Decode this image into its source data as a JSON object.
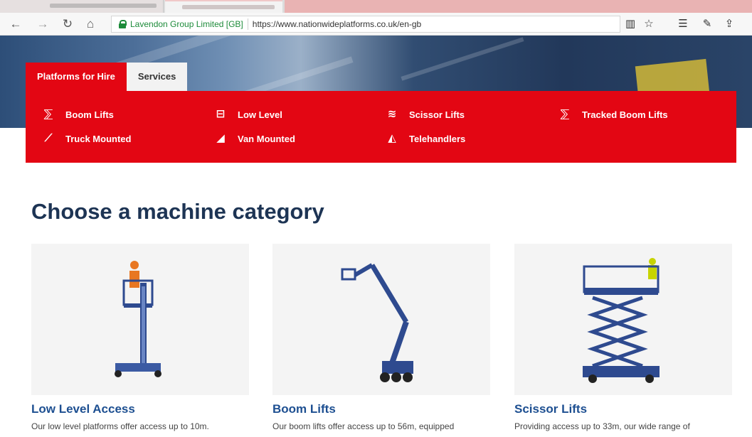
{
  "browser": {
    "cert_name": "Lavendon Group Limited [GB]",
    "url": "https://www.nationwideplatforms.co.uk/en-gb",
    "nav_icons": [
      "back-icon",
      "forward-icon",
      "refresh-icon",
      "home-icon"
    ],
    "right_icons": [
      "reading-view-icon",
      "favorite-star-icon",
      "favorites-hub-icon",
      "pen-icon",
      "share-icon"
    ]
  },
  "header": {
    "tabs": [
      {
        "label": "Platforms for Hire",
        "active": true
      },
      {
        "label": "Services",
        "active": false
      }
    ],
    "menu": [
      {
        "label": "Boom Lifts",
        "icon": "boom-lift-icon"
      },
      {
        "label": "Low Level",
        "icon": "low-level-icon"
      },
      {
        "label": "Scissor Lifts",
        "icon": "scissor-lift-icon"
      },
      {
        "label": "Tracked Boom Lifts",
        "icon": "tracked-boom-lift-icon"
      },
      {
        "label": "Truck Mounted",
        "icon": "truck-mounted-icon"
      },
      {
        "label": "Van Mounted",
        "icon": "van-mounted-icon"
      },
      {
        "label": "Telehandlers",
        "icon": "telehandler-icon"
      }
    ],
    "colors": {
      "red": "#e30613",
      "navy": "#1d3454"
    }
  },
  "main": {
    "heading": "Choose a machine category",
    "cards": [
      {
        "title": "Low Level Access",
        "desc": "Our low level platforms offer access up to 10m."
      },
      {
        "title": "Boom Lifts",
        "desc": "Our boom lifts offer access up to 56m, equipped"
      },
      {
        "title": "Scissor Lifts",
        "desc": "Providing access up to 33m, our wide range of"
      }
    ]
  }
}
